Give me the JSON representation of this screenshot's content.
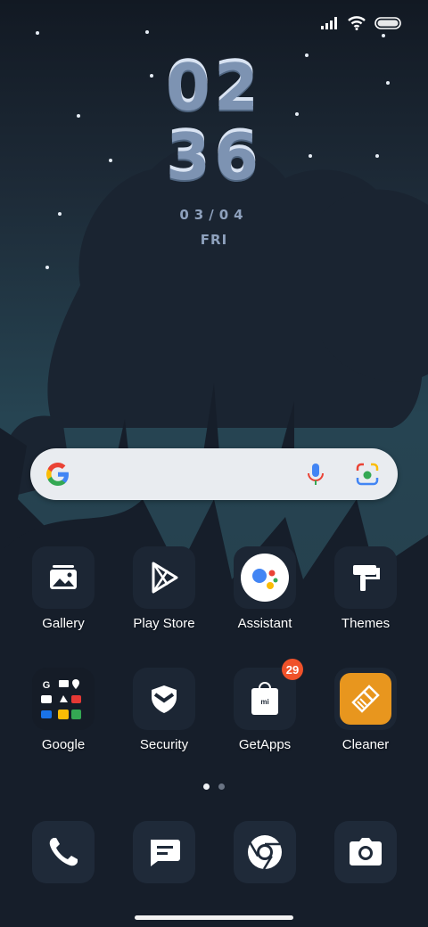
{
  "clock": {
    "hours": "02",
    "minutes": "36",
    "date": "03/04",
    "day": "FRI"
  },
  "search": {
    "engine": "Google",
    "mic_icon": "mic-icon",
    "lens_icon": "camera-lens-icon"
  },
  "apps": [
    {
      "label": "Gallery",
      "icon": "gallery-icon"
    },
    {
      "label": "Play Store",
      "icon": "play-store-icon"
    },
    {
      "label": "Assistant",
      "icon": "assistant-icon"
    },
    {
      "label": "Themes",
      "icon": "themes-icon"
    },
    {
      "label": "Google",
      "icon": "google-folder-icon"
    },
    {
      "label": "Security",
      "icon": "security-icon"
    },
    {
      "label": "GetApps",
      "icon": "getapps-icon",
      "badge": "29",
      "badge_color": "#f0522a"
    },
    {
      "label": "Cleaner",
      "icon": "cleaner-icon",
      "accent": "#e8961e"
    }
  ],
  "dock": [
    {
      "icon": "phone-icon"
    },
    {
      "icon": "messages-icon"
    },
    {
      "icon": "chrome-icon"
    },
    {
      "icon": "camera-icon"
    }
  ],
  "page_indicator": {
    "pages": 2,
    "current": 1
  }
}
